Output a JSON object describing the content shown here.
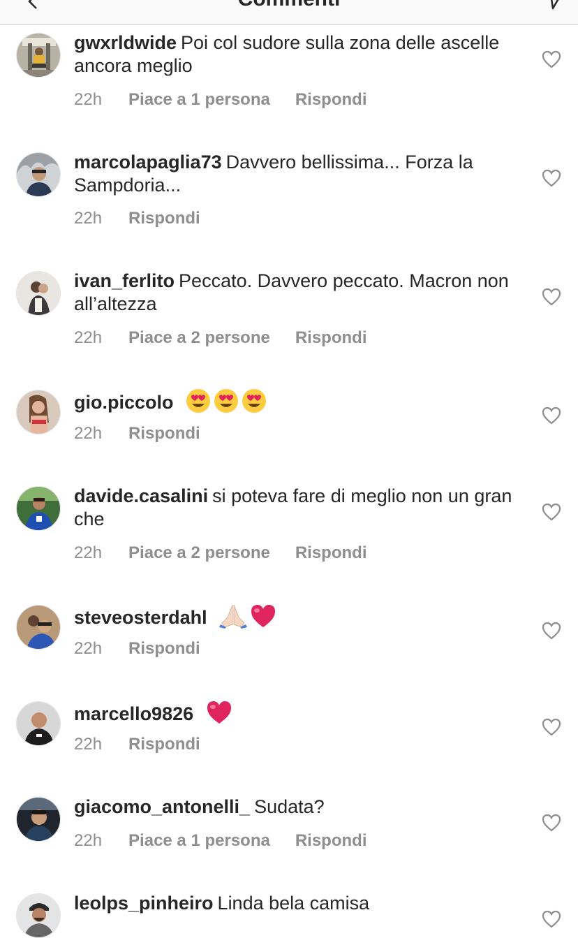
{
  "header": {
    "title": "Commenti"
  },
  "comments": [
    {
      "user": "gwxrldwide",
      "text": "Poi col sudore sulla zona delle ascelle ancora meglio",
      "time": "22h",
      "likes": "Piace a 1 persona",
      "reply": "Rispondi"
    },
    {
      "user": "marcolapaglia73",
      "text": "Davvero bellissima... Forza la Sampdoria...",
      "time": "22h",
      "likes": "",
      "reply": "Rispondi"
    },
    {
      "user": "ivan_ferlito",
      "text": "Peccato. Davvero peccato. Macron non all’altezza",
      "time": "22h",
      "likes": "Piace a 2 persone",
      "reply": "Rispondi"
    },
    {
      "user": "gio.piccolo",
      "text": "",
      "emoji": [
        "heart-eyes-emoji",
        "heart-eyes-emoji",
        "heart-eyes-emoji"
      ],
      "time": "22h",
      "likes": "",
      "reply": "Rispondi"
    },
    {
      "user": "davide.casalini",
      "text": "si poteva fare di meglio non un gran che",
      "time": "22h",
      "likes": "Piace a 2 persone",
      "reply": "Rispondi"
    },
    {
      "user": "steveosterdahl",
      "text": "",
      "emoji": [
        "folded-hands-emoji",
        "red-heart-emoji"
      ],
      "time": "22h",
      "likes": "",
      "reply": "Rispondi"
    },
    {
      "user": "marcello9826",
      "text": "",
      "emoji": [
        "red-heart-emoji"
      ],
      "time": "22h",
      "likes": "",
      "reply": "Rispondi"
    },
    {
      "user": "giacomo_antonelli_",
      "text": "Sudata?",
      "time": "22h",
      "likes": "Piace a 1 persona",
      "reply": "Rispondi"
    },
    {
      "user": "leolps_pinheiro",
      "text": "Linda bela camisa",
      "time": "",
      "likes": "",
      "reply": ""
    }
  ],
  "colors": {
    "text": "#262626",
    "meta": "#8e8e8e",
    "heart_outline": "#8e8e8e",
    "emoji_heart": "#e0245e",
    "emoji_face": "#ffcc3e"
  }
}
